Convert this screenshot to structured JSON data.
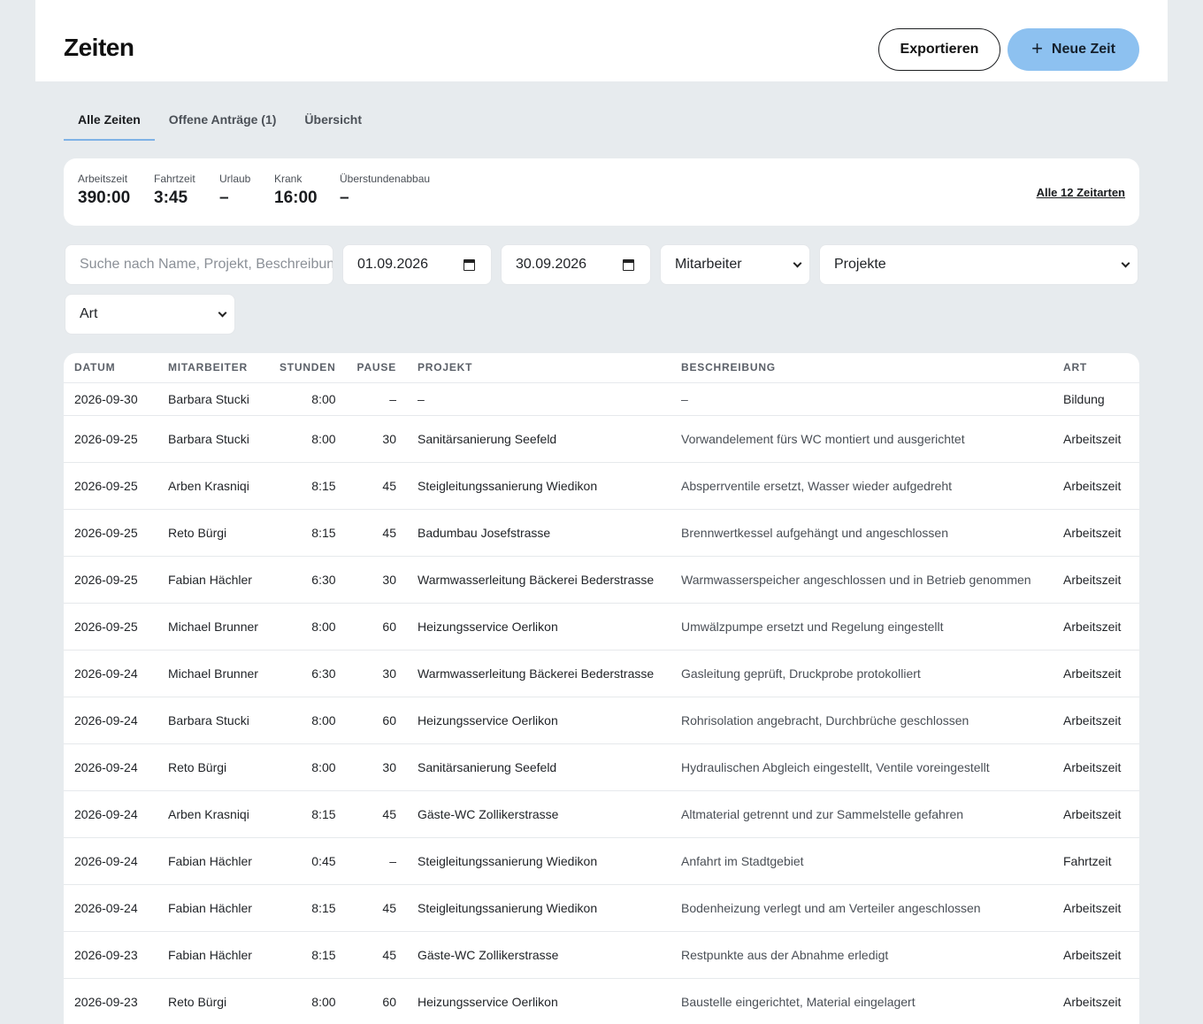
{
  "header": {
    "title": "Zeiten",
    "export_label": "Exportieren",
    "new_label": "Neue Zeit",
    "new_icon": "plus-icon"
  },
  "tabs": [
    {
      "label": "Alle Zeiten",
      "active": true
    },
    {
      "label": "Offene Anträge (1)",
      "active": false
    },
    {
      "label": "Übersicht",
      "active": false
    }
  ],
  "stats": {
    "items": [
      {
        "label": "Arbeitszeit",
        "value": "390:00"
      },
      {
        "label": "Fahrtzeit",
        "value": "3:45"
      },
      {
        "label": "Urlaub",
        "value": "–"
      },
      {
        "label": "Krank",
        "value": "16:00"
      },
      {
        "label": "Überstundenabbau",
        "value": "–"
      }
    ],
    "link": "Alle 12 Zeitarten"
  },
  "filters": {
    "search_placeholder": "Suche nach Name, Projekt, Beschreibung",
    "date_from": "01.09.2026",
    "date_to": "30.09.2026",
    "employee": "Mitarbeiter",
    "projects": "Projekte",
    "type": "Art"
  },
  "table": {
    "columns": [
      "DATUM",
      "MITARBEITER",
      "STUNDEN",
      "PAUSE",
      "PROJEKT",
      "BESCHREIBUNG",
      "ART"
    ],
    "rows": [
      [
        "2026-09-30",
        "Barbara Stucki",
        "8:00",
        "–",
        "–",
        "–",
        "Bildung"
      ],
      [
        "2026-09-25",
        "Barbara Stucki",
        "8:00",
        "30",
        "Sanitärsanierung Seefeld",
        "Vorwandelement fürs WC montiert und ausgerichtet",
        "Arbeitszeit"
      ],
      [
        "2026-09-25",
        "Arben Krasniqi",
        "8:15",
        "45",
        "Steigleitungssanierung Wiedikon",
        "Absperrventile ersetzt, Wasser wieder aufgedreht",
        "Arbeitszeit"
      ],
      [
        "2026-09-25",
        "Reto Bürgi",
        "8:15",
        "45",
        "Badumbau Josefstrasse",
        "Brennwertkessel aufgehängt und angeschlossen",
        "Arbeitszeit"
      ],
      [
        "2026-09-25",
        "Fabian Hächler",
        "6:30",
        "30",
        "Warmwasserleitung Bäckerei Bederstrasse",
        "Warmwasserspeicher angeschlossen und in Betrieb genommen",
        "Arbeitszeit"
      ],
      [
        "2026-09-25",
        "Michael Brunner",
        "8:00",
        "60",
        "Heizungsservice Oerlikon",
        "Umwälzpumpe ersetzt und Regelung eingestellt",
        "Arbeitszeit"
      ],
      [
        "2026-09-24",
        "Michael Brunner",
        "6:30",
        "30",
        "Warmwasserleitung Bäckerei Bederstrasse",
        "Gasleitung geprüft, Druckprobe protokolliert",
        "Arbeitszeit"
      ],
      [
        "2026-09-24",
        "Barbara Stucki",
        "8:00",
        "60",
        "Heizungsservice Oerlikon",
        "Rohrisolation angebracht, Durchbrüche geschlossen",
        "Arbeitszeit"
      ],
      [
        "2026-09-24",
        "Reto Bürgi",
        "8:00",
        "30",
        "Sanitärsanierung Seefeld",
        "Hydraulischen Abgleich eingestellt, Ventile voreingestellt",
        "Arbeitszeit"
      ],
      [
        "2026-09-24",
        "Arben Krasniqi",
        "8:15",
        "45",
        "Gäste-WC Zollikerstrasse",
        "Altmaterial getrennt und zur Sammelstelle gefahren",
        "Arbeitszeit"
      ],
      [
        "2026-09-24",
        "Fabian Hächler",
        "0:45",
        "–",
        "Steigleitungssanierung Wiedikon",
        "Anfahrt im Stadtgebiet",
        "Fahrtzeit"
      ],
      [
        "2026-09-24",
        "Fabian Hächler",
        "8:15",
        "45",
        "Steigleitungssanierung Wiedikon",
        "Bodenheizung verlegt und am Verteiler angeschlossen",
        "Arbeitszeit"
      ],
      [
        "2026-09-23",
        "Fabian Hächler",
        "8:15",
        "45",
        "Gäste-WC Zollikerstrasse",
        "Restpunkte aus der Abnahme erledigt",
        "Arbeitszeit"
      ],
      [
        "2026-09-23",
        "Reto Bürgi",
        "8:00",
        "60",
        "Heizungsservice Oerlikon",
        "Baustelle eingerichtet, Material eingelagert",
        "Arbeitszeit"
      ]
    ]
  }
}
